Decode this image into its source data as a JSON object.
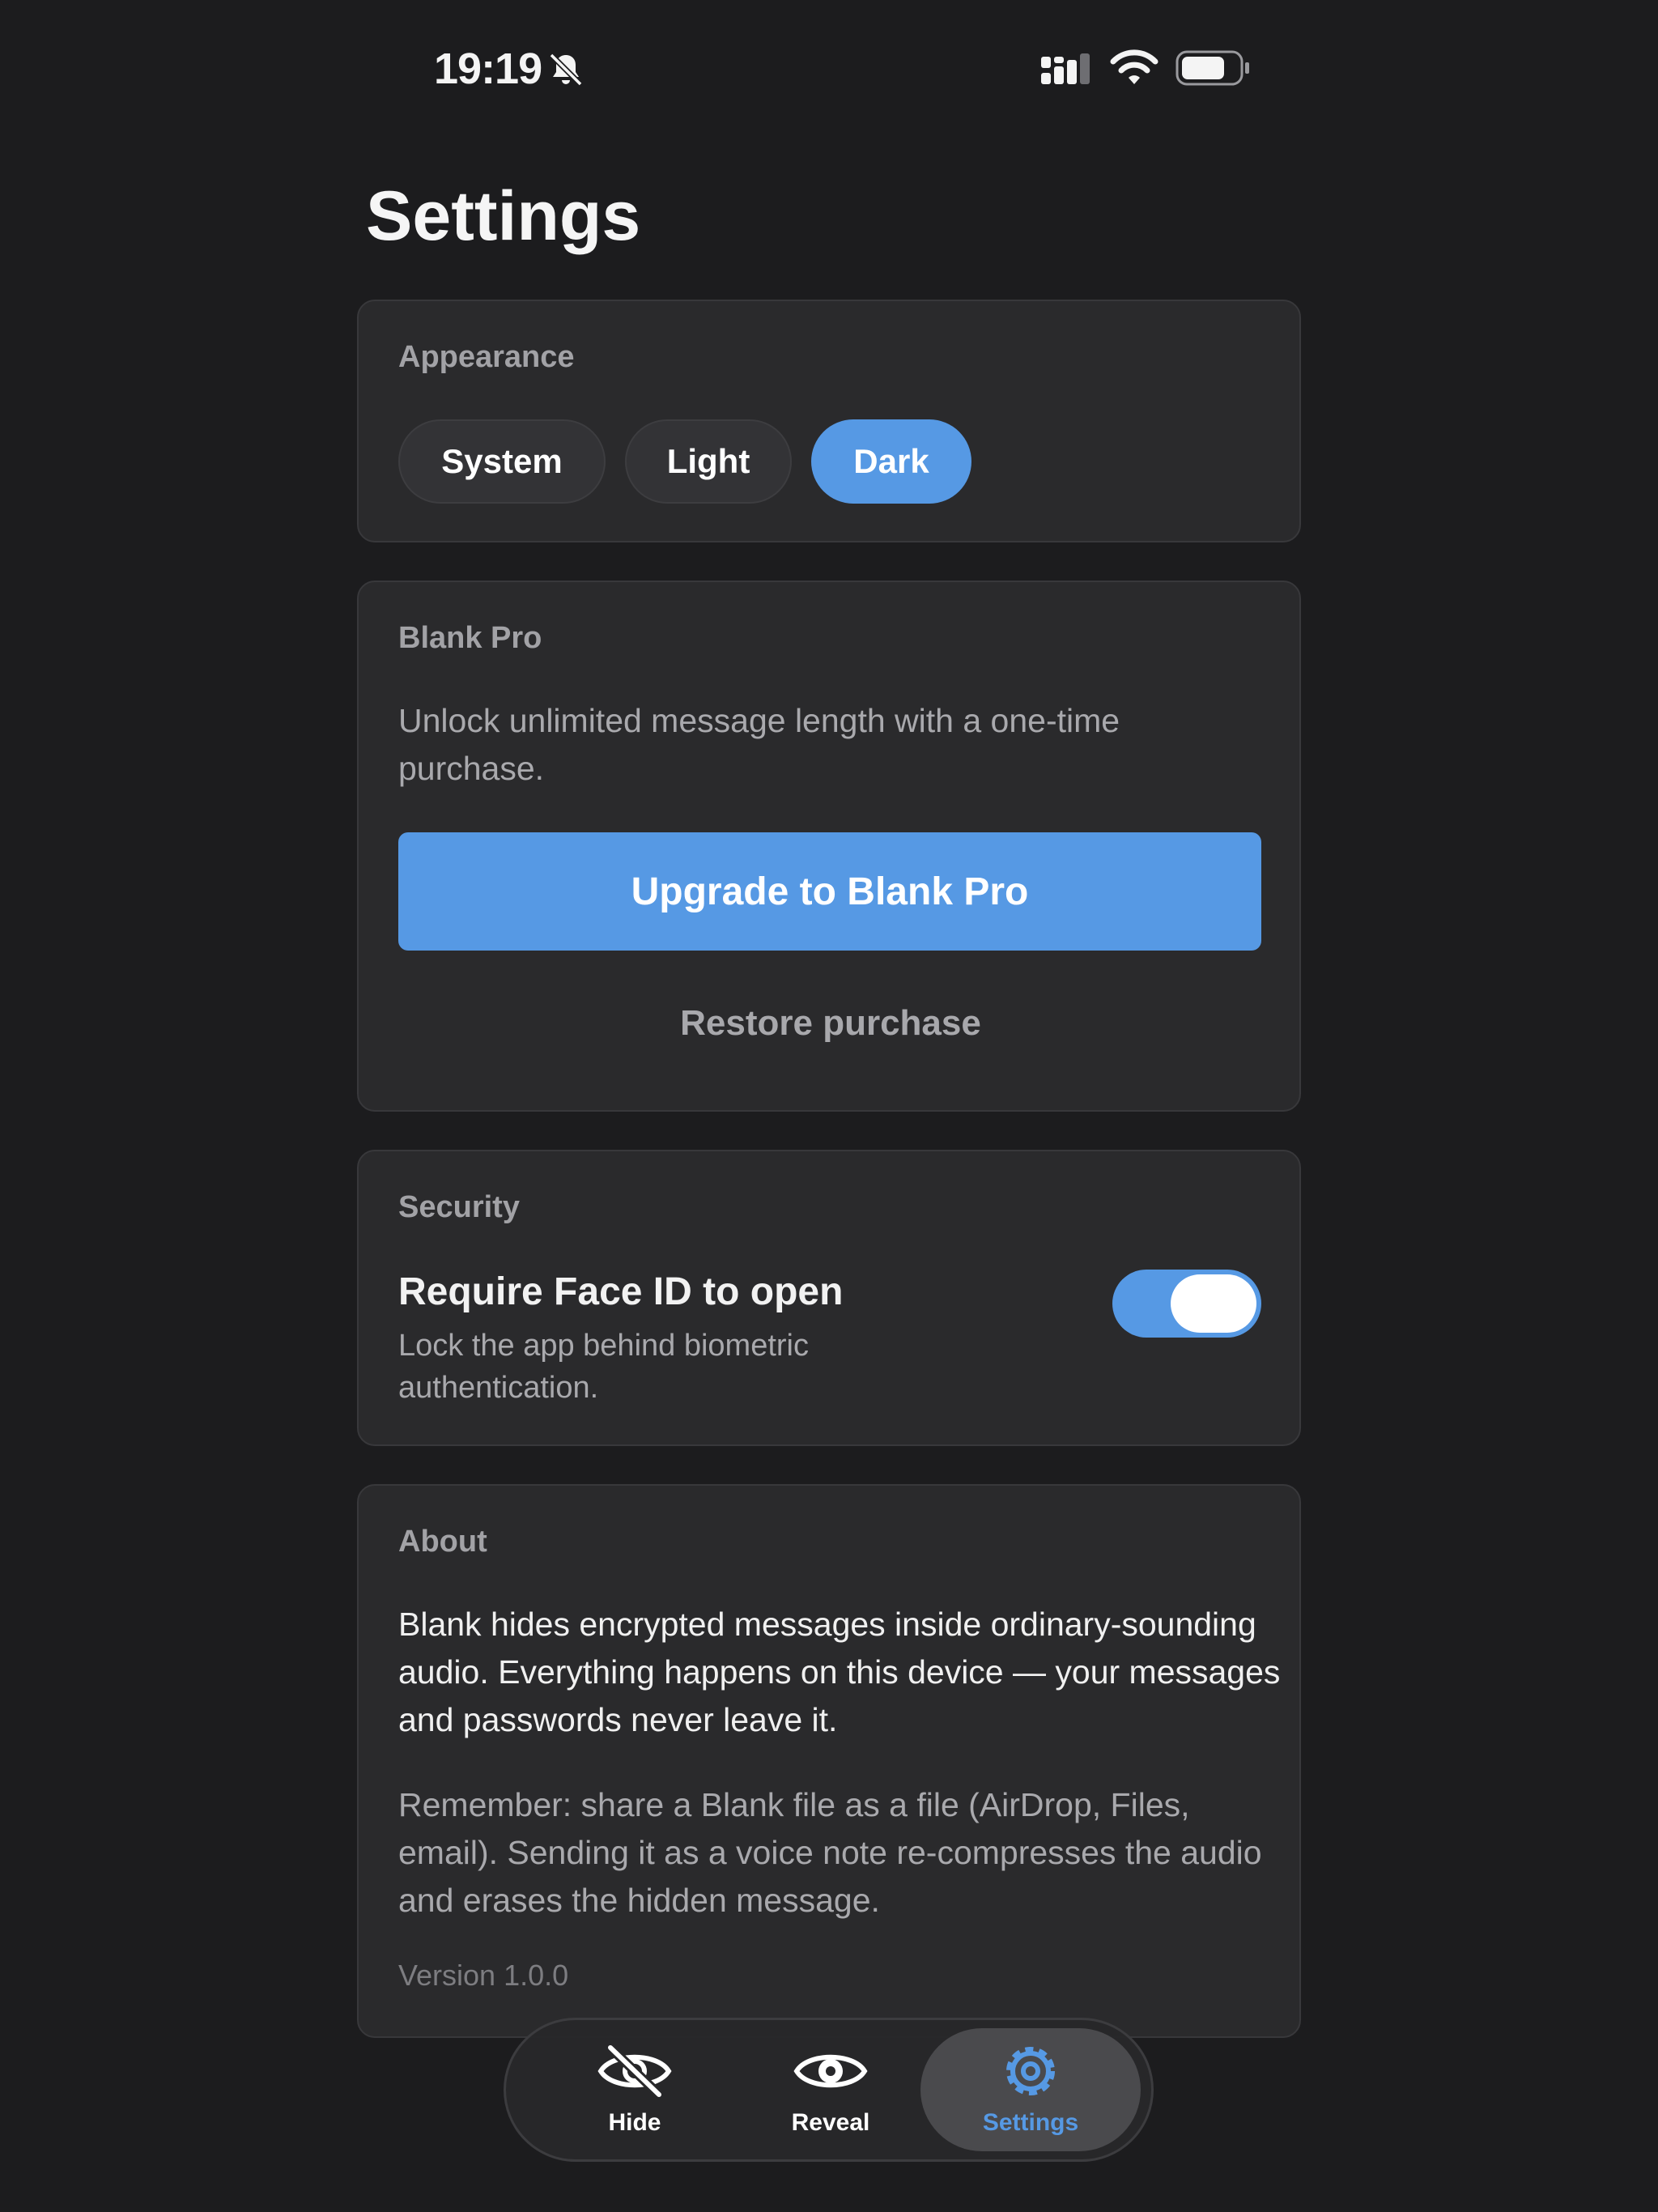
{
  "status_bar": {
    "time": "19:19"
  },
  "page": {
    "title": "Settings"
  },
  "appearance": {
    "label": "Appearance",
    "options": [
      "System",
      "Light",
      "Dark"
    ],
    "selected": "Dark"
  },
  "pro": {
    "label": "Blank Pro",
    "description": "Unlock unlimited message length with a one-time purchase.",
    "upgrade_label": "Upgrade to Blank Pro",
    "restore_label": "Restore purchase"
  },
  "security": {
    "label": "Security",
    "face_id_title": "Require Face ID to open",
    "face_id_description": "Lock the app behind biometric authentication.",
    "face_id_enabled": true
  },
  "about": {
    "label": "About",
    "body": "Blank hides encrypted messages inside ordinary-sounding audio. Everything happens on this device — your messages and passwords never leave it.",
    "note": "Remember: share a Blank file as a file (AirDrop, Files, email). Sending it as a voice note re-compresses the audio and erases the hidden message.",
    "version": "Version 1.0.0"
  },
  "tab_bar": {
    "tabs": [
      {
        "label": "Hide",
        "icon": "eye-slash-icon"
      },
      {
        "label": "Reveal",
        "icon": "eye-icon"
      },
      {
        "label": "Settings",
        "icon": "gear-icon"
      }
    ],
    "selected": "Settings"
  },
  "colors": {
    "background": "#1c1c1e",
    "card": "#2a2a2c",
    "accent": "#5699e4",
    "secondary_text": "#a9a9ad"
  }
}
